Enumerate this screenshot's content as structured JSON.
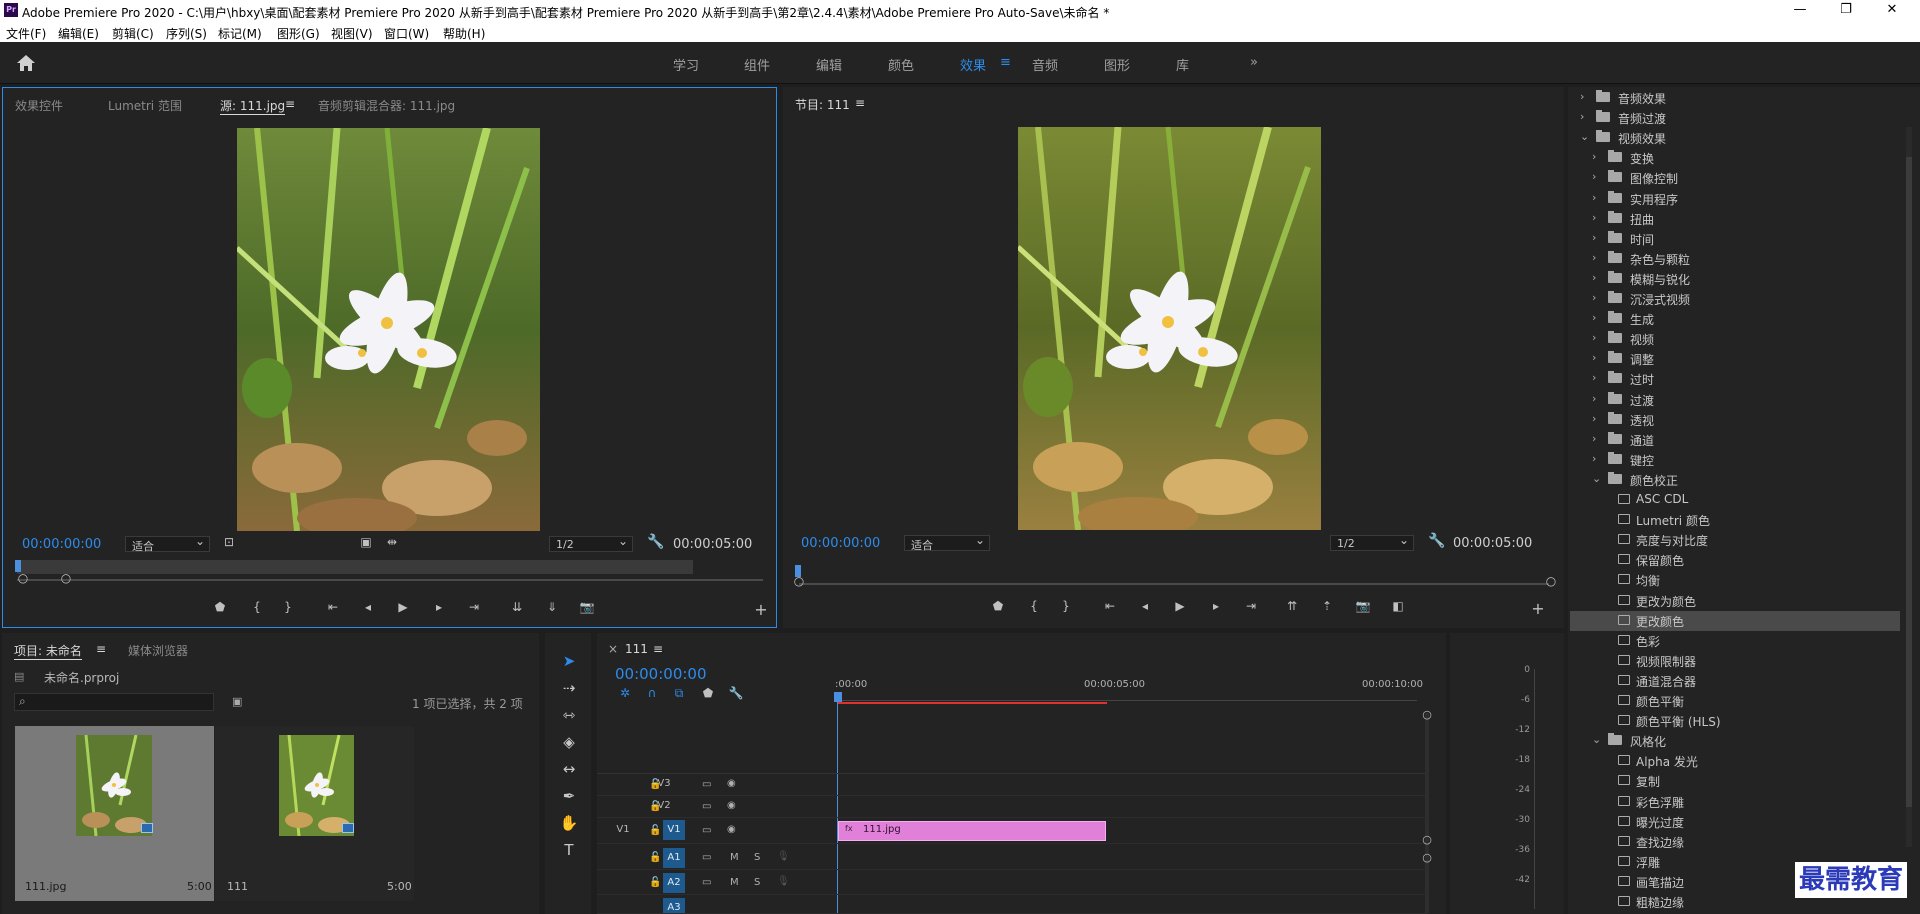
{
  "titlebar": {
    "icon": "Pr",
    "title": "Adobe Premiere Pro 2020 - C:\\用户\\hbxy\\桌面\\配套素材 Premiere Pro 2020 从新手到高手\\配套素材 Premiere Pro 2020 从新手到高手\\第2章\\2.4.4\\素材\\Adobe Premiere Pro Auto-Save\\未命名 *",
    "min": "—",
    "max": "❐",
    "close": "✕"
  },
  "menu": [
    "文件(F)",
    "编辑(E)",
    "剪辑(C)",
    "序列(S)",
    "标记(M)",
    "图形(G)",
    "视图(V)",
    "窗口(W)",
    "帮助(H)"
  ],
  "workspaces": {
    "items": [
      "学习",
      "组件",
      "编辑",
      "颜色",
      "效果",
      "音频",
      "图形",
      "库"
    ],
    "active": "效果",
    "more": "»"
  },
  "source_panel": {
    "tabs": [
      "效果控件",
      "Lumetri 范围",
      "源: 111.jpg",
      "音频剪辑混合器: 111.jpg"
    ],
    "timecode_in": "00:00:00:00",
    "fit": "适合",
    "resolution": "1/2",
    "duration": "00:00:05:00"
  },
  "program_panel": {
    "tab": "节目: 111",
    "timecode_in": "00:00:00:00",
    "fit": "适合",
    "resolution": "1/2",
    "duration": "00:00:05:00"
  },
  "project_panel": {
    "tabs": [
      "项目: 未命名",
      "媒体浏览器"
    ],
    "file": "未命名.prproj",
    "selection": "1 项已选择，共 2 项",
    "items": [
      {
        "name": "111.jpg",
        "duration": "5:00"
      },
      {
        "name": "111",
        "duration": "5:00"
      }
    ]
  },
  "timeline": {
    "tab": "111",
    "close": "×",
    "timecode": "00:00:00:00",
    "ruler": [
      ":00:00",
      "00:00:05:00",
      "00:00:10:00"
    ],
    "tracks_video": [
      "V3",
      "V2",
      "V1"
    ],
    "tracks_audio": [
      "A1",
      "A2",
      "A3"
    ],
    "source_patch": "V1",
    "clip": "111.jpg",
    "m": "M",
    "s": "S"
  },
  "meter": [
    "0",
    "-6",
    "-12",
    "-18",
    "-24",
    "-30",
    "-36",
    "-42"
  ],
  "effects_tree": [
    {
      "label": "音频效果",
      "level": 0,
      "type": "folder",
      "open": false
    },
    {
      "label": "音频过渡",
      "level": 0,
      "type": "folder",
      "open": false
    },
    {
      "label": "视频效果",
      "level": 0,
      "type": "folder",
      "open": true
    },
    {
      "label": "变换",
      "level": 1,
      "type": "folder",
      "open": false
    },
    {
      "label": "图像控制",
      "level": 1,
      "type": "folder",
      "open": false
    },
    {
      "label": "实用程序",
      "level": 1,
      "type": "folder",
      "open": false
    },
    {
      "label": "扭曲",
      "level": 1,
      "type": "folder",
      "open": false
    },
    {
      "label": "时间",
      "level": 1,
      "type": "folder",
      "open": false
    },
    {
      "label": "杂色与颗粒",
      "level": 1,
      "type": "folder",
      "open": false
    },
    {
      "label": "模糊与锐化",
      "level": 1,
      "type": "folder",
      "open": false
    },
    {
      "label": "沉浸式视频",
      "level": 1,
      "type": "folder",
      "open": false
    },
    {
      "label": "生成",
      "level": 1,
      "type": "folder",
      "open": false
    },
    {
      "label": "视频",
      "level": 1,
      "type": "folder",
      "open": false
    },
    {
      "label": "调整",
      "level": 1,
      "type": "folder",
      "open": false
    },
    {
      "label": "过时",
      "level": 1,
      "type": "folder",
      "open": false
    },
    {
      "label": "过渡",
      "level": 1,
      "type": "folder",
      "open": false
    },
    {
      "label": "透视",
      "level": 1,
      "type": "folder",
      "open": false
    },
    {
      "label": "通道",
      "level": 1,
      "type": "folder",
      "open": false
    },
    {
      "label": "键控",
      "level": 1,
      "type": "folder",
      "open": false
    },
    {
      "label": "颜色校正",
      "level": 1,
      "type": "folder",
      "open": true
    },
    {
      "label": "ASC CDL",
      "level": 2,
      "type": "effect"
    },
    {
      "label": "Lumetri 颜色",
      "level": 2,
      "type": "effect"
    },
    {
      "label": "亮度与对比度",
      "level": 2,
      "type": "effect"
    },
    {
      "label": "保留颜色",
      "level": 2,
      "type": "effect"
    },
    {
      "label": "均衡",
      "level": 2,
      "type": "effect"
    },
    {
      "label": "更改为颜色",
      "level": 2,
      "type": "effect"
    },
    {
      "label": "更改颜色",
      "level": 2,
      "type": "effect",
      "selected": true
    },
    {
      "label": "色彩",
      "level": 2,
      "type": "effect"
    },
    {
      "label": "视频限制器",
      "level": 2,
      "type": "effect"
    },
    {
      "label": "通道混合器",
      "level": 2,
      "type": "effect"
    },
    {
      "label": "颜色平衡",
      "level": 2,
      "type": "effect"
    },
    {
      "label": "颜色平衡 (HLS)",
      "level": 2,
      "type": "effect"
    },
    {
      "label": "风格化",
      "level": 1,
      "type": "folder",
      "open": true
    },
    {
      "label": "Alpha 发光",
      "level": 2,
      "type": "effect"
    },
    {
      "label": "复制",
      "level": 2,
      "type": "effect"
    },
    {
      "label": "彩色浮雕",
      "level": 2,
      "type": "effect"
    },
    {
      "label": "曝光过度",
      "level": 2,
      "type": "effect"
    },
    {
      "label": "查找边缘",
      "level": 2,
      "type": "effect"
    },
    {
      "label": "浮雕",
      "level": 2,
      "type": "effect"
    },
    {
      "label": "画笔描边",
      "level": 2,
      "type": "effect"
    },
    {
      "label": "粗糙边缘",
      "level": 2,
      "type": "effect"
    }
  ],
  "watermark": "最需教育",
  "colors": {
    "accent": "#2d8ceb",
    "clip": "#e080d8",
    "playhead": "#4a8fe0",
    "work_area": "#e03030"
  }
}
